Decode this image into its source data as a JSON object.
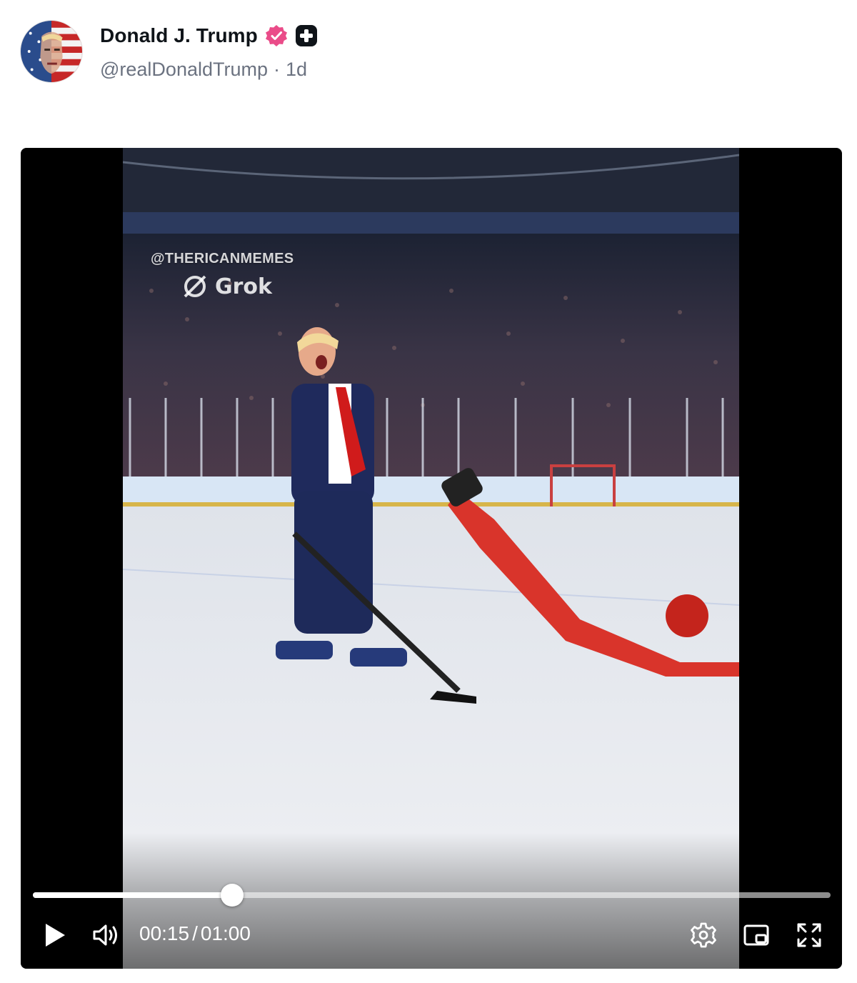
{
  "post": {
    "display_name": "Donald J. Trump",
    "handle": "@realDonaldTrump",
    "separator": "·",
    "age": "1d",
    "verified_badge_icon": "verified-badge-icon",
    "plus_badge_icon": "plus-badge-icon"
  },
  "video": {
    "watermark_text": "@THERICANMEMES",
    "watermark_logo_text": "Grok",
    "current_time": "00:15",
    "time_separator": "/",
    "duration": "01:00",
    "progress": 0.25,
    "icons": {
      "play": "play-icon",
      "volume": "volume-icon",
      "settings": "gear-icon",
      "pip": "picture-in-picture-icon",
      "fullscreen": "fullscreen-icon"
    }
  },
  "colors": {
    "badge_pink": "#ea4c89",
    "text_primary": "#0f1419",
    "text_secondary": "#6b7280",
    "player_bg": "#000000"
  }
}
